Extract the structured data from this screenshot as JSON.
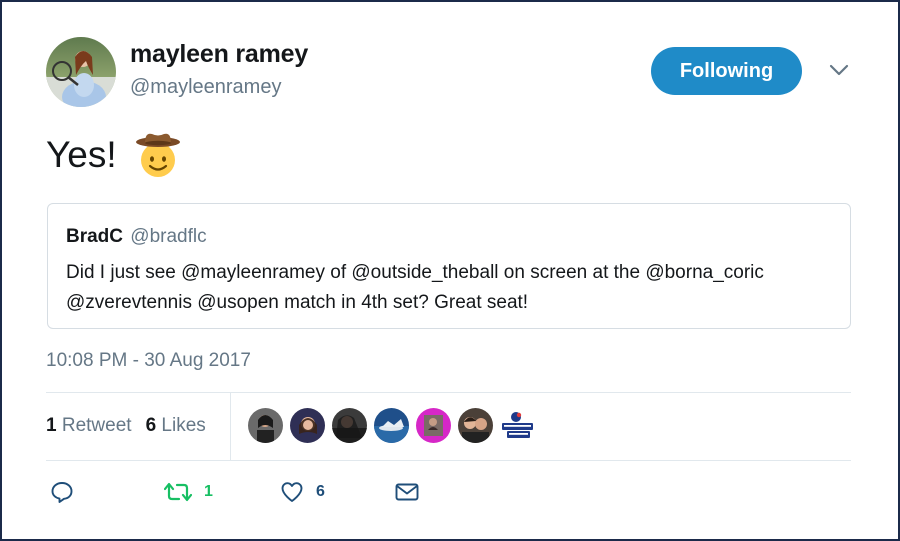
{
  "author": {
    "name": "mayleen ramey",
    "handle": "@mayleenramey"
  },
  "follow_button_label": "Following",
  "tweet": {
    "text": "Yes!",
    "emoji": "cowboy-hat-face-icon"
  },
  "quoted_tweet": {
    "name": "BradC",
    "handle": "@bradflc",
    "text": "Did I just see @mayleenramey of @outside_theball on screen at the @borna_coric @zverevtennis @usopen match in 4th set?  Great seat!"
  },
  "timestamp": "10:08 PM - 30 Aug 2017",
  "stats": {
    "retweet_count": "1",
    "retweet_label": "Retweet",
    "like_count": "6",
    "like_label": "Likes"
  },
  "likers": [
    {
      "name": "liker-avatar-1"
    },
    {
      "name": "liker-avatar-2"
    },
    {
      "name": "liker-avatar-3"
    },
    {
      "name": "liker-avatar-4"
    },
    {
      "name": "liker-avatar-5"
    },
    {
      "name": "liker-avatar-6"
    },
    {
      "name": "liker-avatar-outside-the-ball",
      "logo_text": "Outside the Ball"
    }
  ],
  "actions": {
    "reply_icon": "reply-icon",
    "retweet_icon": "retweet-icon",
    "retweet_count": "1",
    "like_icon": "heart-icon",
    "like_count": "6",
    "dm_icon": "envelope-icon"
  },
  "colors": {
    "follow_button": "#1f8bc8",
    "retweet_green": "#17bf63",
    "muted_text": "#657786",
    "border": "#e1e8ed"
  }
}
